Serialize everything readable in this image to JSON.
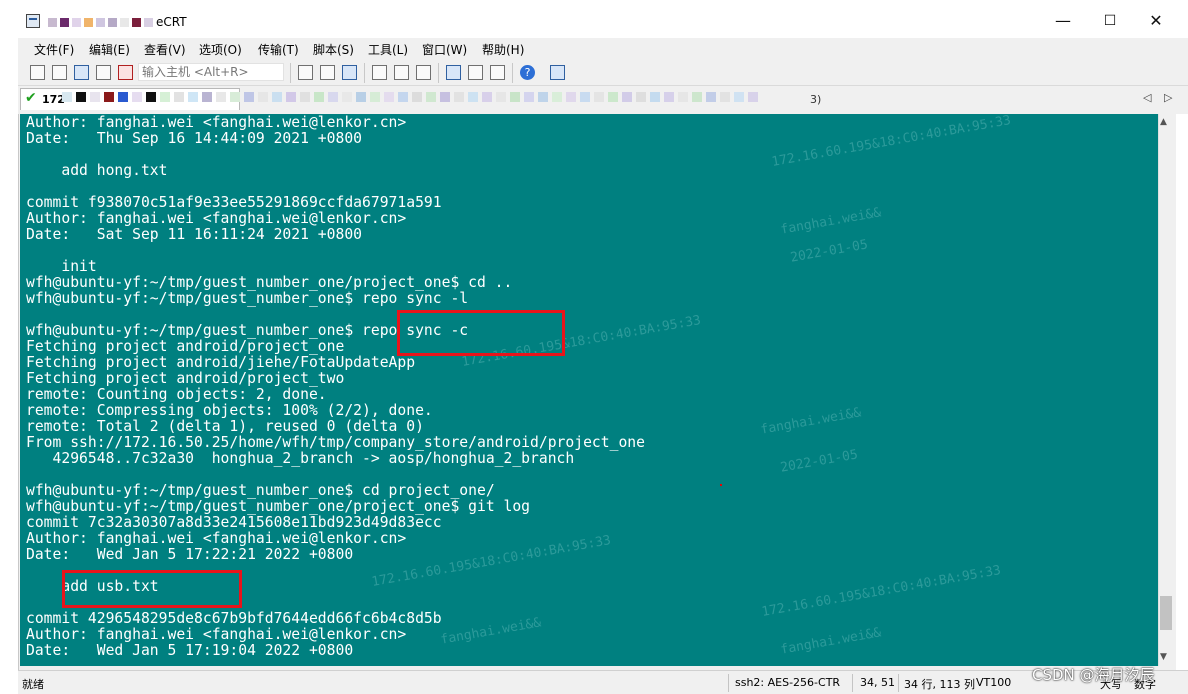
{
  "window": {
    "title_suffix": "eCRT",
    "controls": {
      "minimize": "—",
      "maximize": "☐",
      "close": "✕"
    }
  },
  "menu": {
    "items": [
      "文件(F)",
      "编辑(E)",
      "查看(V)",
      "选项(O)",
      "传输(T)",
      "脚本(S)",
      "工具(L)",
      "窗口(W)",
      "帮助(H)"
    ]
  },
  "toolbar": {
    "quick_connect_placeholder": "输入主机 <Alt+R>",
    "help_glyph": "?"
  },
  "tab": {
    "label": "172",
    "suffix": "3)",
    "left_arrow": "◁",
    "right_arrow": "▷",
    "check_glyph": "✔"
  },
  "terminal": {
    "lines": [
      "Author: fanghai.wei <fanghai.wei@lenkor.cn>",
      "Date:   Thu Sep 16 14:44:09 2021 +0800",
      "",
      "    add hong.txt",
      "",
      "commit f938070c51af9e33ee55291869ccfda67971a591",
      "Author: fanghai.wei <fanghai.wei@lenkor.cn>",
      "Date:   Sat Sep 11 16:11:24 2021 +0800",
      "",
      "    init",
      "wfh@ubuntu-yf:~/tmp/guest_number_one/project_one$ cd ..",
      "wfh@ubuntu-yf:~/tmp/guest_number_one$ repo sync -l",
      "",
      "wfh@ubuntu-yf:~/tmp/guest_number_one$ repo sync -c",
      "Fetching project android/project_one",
      "Fetching project android/jiehe/FotaUpdateApp",
      "Fetching project android/project_two",
      "remote: Counting objects: 2, done.",
      "remote: Compressing objects: 100% (2/2), done.",
      "remote: Total 2 (delta 1), reused 0 (delta 0)",
      "From ssh://172.16.50.25/home/wfh/tmp/company_store/android/project_one",
      "   4296548..7c32a30  honghua_2_branch -> aosp/honghua_2_branch",
      "",
      "wfh@ubuntu-yf:~/tmp/guest_number_one$ cd project_one/",
      "wfh@ubuntu-yf:~/tmp/guest_number_one/project_one$ git log",
      "commit 7c32a30307a8d33e2415608e11bd923d49d83ecc",
      "Author: fanghai.wei <fanghai.wei@lenkor.cn>",
      "Date:   Wed Jan 5 17:22:21 2022 +0800",
      "",
      "    add usb.txt",
      "",
      "commit 4296548295de8c67b9bfd7644edd66fc6b4c8d5b",
      "Author: fanghai.wei <fanghai.wei@lenkor.cn>",
      "Date:   Wed Jan 5 17:19:04 2022 +0800"
    ]
  },
  "statusbar": {
    "ready": "就绪",
    "cipher": "ssh2: AES-256-CTR",
    "cursor": "34,  51",
    "size": "34 行, 113 列",
    "emulation": "VT100",
    "caps": "大写",
    "num": "数字"
  },
  "overlay": {
    "csdn_watermark": "CSDN @海月汐辰"
  },
  "colors": {
    "terminal_bg": "#008080",
    "terminal_fg": "#ffffff",
    "highlight_box": "#e8141b"
  }
}
